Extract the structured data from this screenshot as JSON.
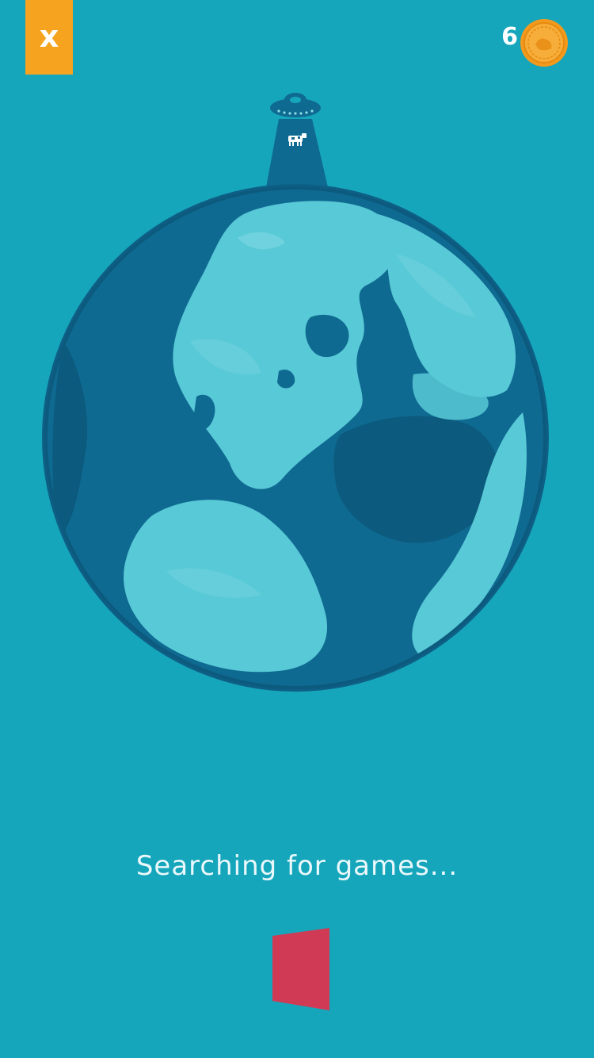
{
  "header": {
    "close_label": "x",
    "coin_count": "6"
  },
  "status": {
    "message": "Searching for games..."
  },
  "icons": {
    "close": "close-icon",
    "coin": "coin-icon",
    "ufo": "ufo-icon",
    "cow": "cow-icon",
    "globe": "globe-icon",
    "loader": "loading-card-icon"
  },
  "colors": {
    "background": "#16a6bb",
    "close_button": "#f6a31f",
    "coin": "#f39a1d",
    "ocean": "#0f6a92",
    "land": "#58c9d6",
    "loader": "#d13a55",
    "text": "#eaf8fb"
  }
}
